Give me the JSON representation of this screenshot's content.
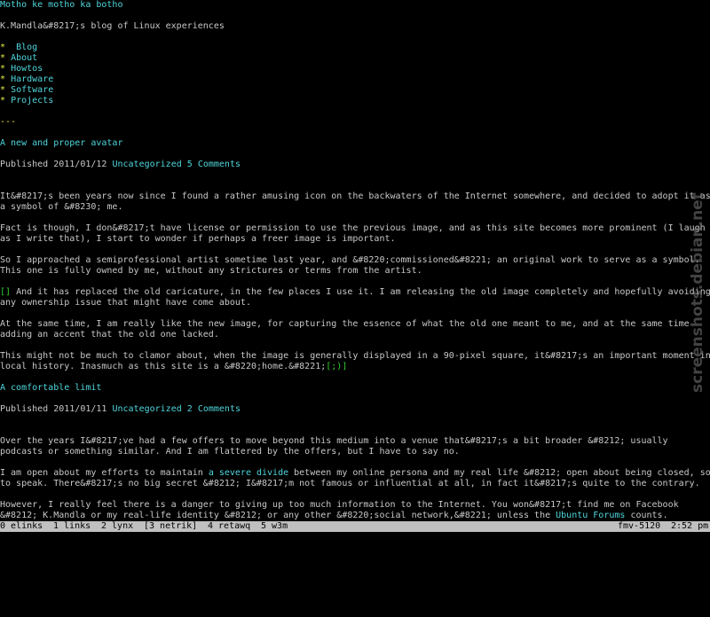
{
  "site": {
    "title": "Motho ke motho ka botho",
    "tagline": "K.Mandla&#8217;s blog of Linux experiences"
  },
  "nav": {
    "bullet": "*",
    "items": [
      "Blog",
      "About",
      "Howtos",
      "Hardware",
      "Software",
      "Projects"
    ],
    "separator": "---"
  },
  "posts": [
    {
      "title": "A new and proper avatar",
      "published_label": "Published",
      "date": "2011/01/12",
      "category": "Uncategorized",
      "comments": "5 Comments",
      "paragraphs": [
        {
          "lines": [
            "It&#8217;s been years now since I found a rather amusing icon on the backwaters of the Internet somewhere, and decided to adopt it as",
            "a symbol of &#8230; me."
          ]
        },
        {
          "lines": [
            "Fact is though, I don&#8217;t have license or permission to use the previous image, and as this site becomes more prominent (I laugh",
            "as I write that), I start to wonder if perhaps a freer image is important."
          ]
        },
        {
          "lines": [
            "So I approached a semiprofessional artist sometime last year, and &#8220;commissioned&#8221; an original work to serve as a symbol.",
            "This one is fully owned by me, without any strictures or terms from the artist."
          ]
        },
        {
          "image_link": "[]",
          "lines": [
            " And it has replaced the old caricature, in the few places I use it. I am releasing the old image completely and hopefully avoiding",
            "any ownership issue that might have come about."
          ]
        },
        {
          "lines": [
            "At the same time, I am really like the new image, for capturing the essence of what the old one meant to me, and at the same time",
            "adding an accent that the old one lacked."
          ]
        },
        {
          "lines": [
            "This might not be much to clamor about, when the image is generally displayed in a 90-pixel square, it&#8217;s an important moment in",
            "local history. Inasmuch as this site is a &#8220;home.&#8221;"
          ],
          "trailing_link": "[;)]"
        }
      ]
    },
    {
      "title": "A comfortable limit",
      "published_label": "Published",
      "date": "2011/01/11",
      "category": "Uncategorized",
      "comments": "2 Comments",
      "paragraphs": [
        {
          "lines": [
            "Over the years I&#8217;ve had a few offers to move beyond this medium into a venue that&#8217;s a bit broader &#8212; usually",
            "podcasts or something similar. And I am flattered by the offers, but I have to say no."
          ]
        },
        {
          "line1_before": "I am open about my efforts to maintain ",
          "line1_link": "a severe divide",
          "line1_after": " between my online persona and my real life &#8212; open about being closed, so",
          "line2": "to speak. There&#8217;s no big secret &#8212; I&#8217;m not famous or influential at all, in fact it&#8217;s quite to the contrary."
        },
        {
          "line1": "However, I really feel there is a danger to giving up too much information to the Internet. You won&#8217;t find me on Facebook",
          "line2_before": "&#8212; K.Mandla or my real-life identity &#8212; or any other &#8220;social network,&#8221; unless the ",
          "line2_link": "Ubuntu Forums",
          "line2_after": " counts."
        }
      ]
    }
  ],
  "statusbar": {
    "tabs": [
      "0 elinks",
      "1 links",
      "2 lynx",
      "[3 netrik]",
      "4 retawq",
      "5 w3m"
    ],
    "host": "fmv-5120",
    "time": "2:52 pm"
  },
  "watermark": "screenshots.debian.net",
  "colors": {
    "background": "#000000",
    "text": "#c8c8c8",
    "link": "#4fd6dc",
    "bullet": "#e6e64a",
    "statusbar": "#c0c0c0"
  }
}
